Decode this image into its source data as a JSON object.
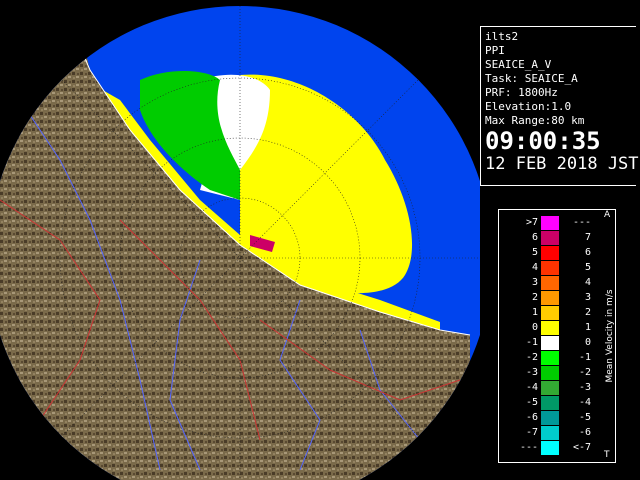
{
  "info": {
    "station": "ilts2",
    "product": "PPI",
    "source": "SEAICE_A_V",
    "task": "Task: SEAICE_A",
    "prf": "PRF: 1800Hz",
    "elevation": "Elevation:1.0",
    "max_range": "Max Range:80 km",
    "time": "09:00:35",
    "date": "12 FEB 2018 JST"
  },
  "legend": {
    "title": "Mean Velocity in m/s",
    "corner_top": "A",
    "corner_bottom": "T",
    "rows": [
      {
        "left": ">7",
        "right": "---",
        "color": "#ff00ff"
      },
      {
        "left": "6",
        "right": "7",
        "color": "#cc0066"
      },
      {
        "left": "5",
        "right": "6",
        "color": "#ff0000"
      },
      {
        "left": "4",
        "right": "5",
        "color": "#ff3300"
      },
      {
        "left": "3",
        "right": "4",
        "color": "#ff6600"
      },
      {
        "left": "2",
        "right": "3",
        "color": "#ff9900"
      },
      {
        "left": "1",
        "right": "2",
        "color": "#ffcc00"
      },
      {
        "left": "0",
        "right": "1",
        "color": "#ffff00"
      },
      {
        "left": "-1",
        "right": "0",
        "color": "#ffffff"
      },
      {
        "left": "-2",
        "right": "-1",
        "color": "#00ff00"
      },
      {
        "left": "-3",
        "right": "-2",
        "color": "#00cc00"
      },
      {
        "left": "-4",
        "right": "-3",
        "color": "#33aa33"
      },
      {
        "left": "-5",
        "right": "-4",
        "color": "#009966"
      },
      {
        "left": "-6",
        "right": "-5",
        "color": "#009999"
      },
      {
        "left": "-7",
        "right": "-6",
        "color": "#00cccc"
      },
      {
        "left": "---",
        "right": "<-7",
        "color": "#00ffff"
      }
    ]
  },
  "colors": {
    "water": "#0044ee",
    "outside": "#000000",
    "land": "#7a6a4a"
  }
}
